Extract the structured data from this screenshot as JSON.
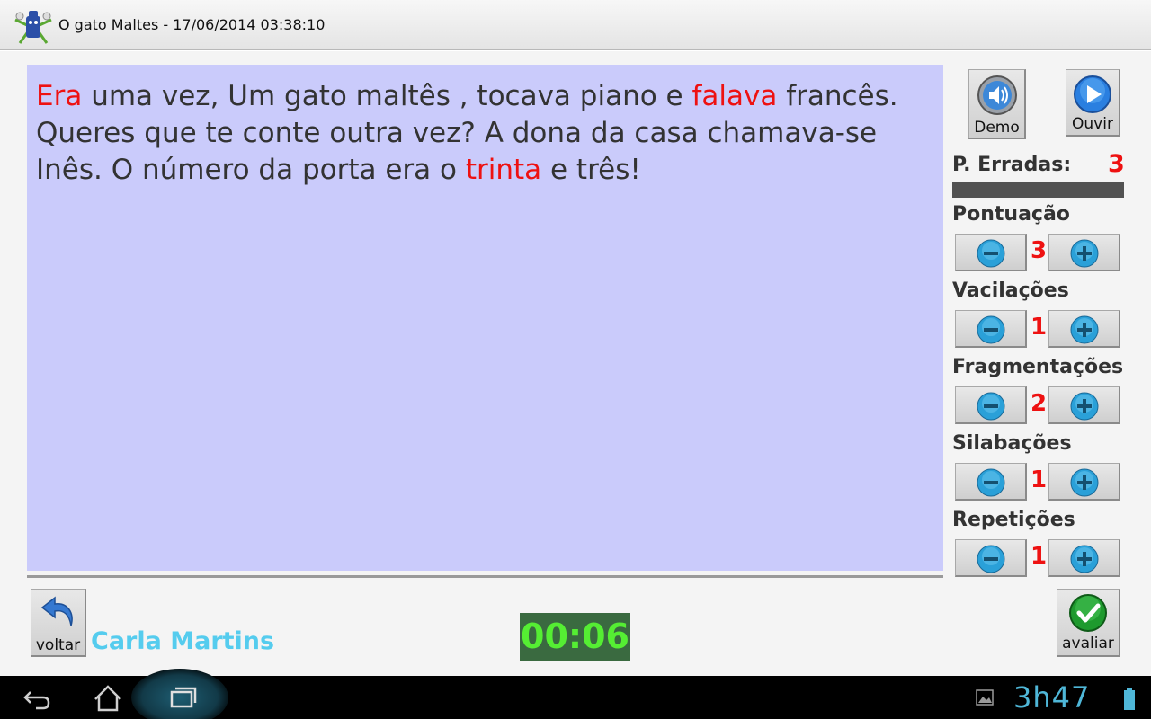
{
  "window": {
    "title": "O gato Maltes - 17/06/2014 03:38:10"
  },
  "reading": {
    "segments": [
      {
        "text": "Era",
        "error": true
      },
      {
        "text": " uma vez, Um gato maltês , tocava piano e ",
        "error": false
      },
      {
        "text": "falava",
        "error": true
      },
      {
        "text": " francês. Queres que te conte outra vez?  A dona da casa chamava-se Inês. O número da porta era o ",
        "error": false
      },
      {
        "text": "trinta",
        "error": true
      },
      {
        "text": " e três!",
        "error": false
      }
    ]
  },
  "toolbar": {
    "demo_label": "Demo",
    "ouvir_label": "Ouvir"
  },
  "stats": {
    "errors_label": "P. Erradas:",
    "errors_value": "3"
  },
  "counters": [
    {
      "label": "Pontuação",
      "value": "3"
    },
    {
      "label": "Vacilações",
      "value": "1"
    },
    {
      "label": "Fragmentações",
      "value": "2"
    },
    {
      "label": "Silabações",
      "value": "1"
    },
    {
      "label": "Repetições",
      "value": "1"
    }
  ],
  "footer": {
    "back_label": "voltar",
    "student_name": "Carla Martins",
    "timer": "00:06",
    "evaluate_label": "avaliar"
  },
  "statusbar": {
    "clock": "3h47"
  },
  "colors": {
    "reading_bg": "#cacbfb",
    "error_text": "#ee1111",
    "timer_bg": "#3a6a40",
    "timer_text": "#55ee33",
    "student_name": "#55ccee"
  },
  "icons": {
    "app": "gato-app-icon",
    "demo": "speaker-icon",
    "ouvir": "play-icon",
    "minus": "minus-icon",
    "plus": "plus-icon",
    "back": "undo-arrow-icon",
    "evaluate": "checkmark-icon",
    "nav_back": "nav-back-icon",
    "nav_home": "nav-home-icon",
    "nav_recent": "nav-recent-icon",
    "gallery": "gallery-icon",
    "battery": "battery-icon"
  }
}
